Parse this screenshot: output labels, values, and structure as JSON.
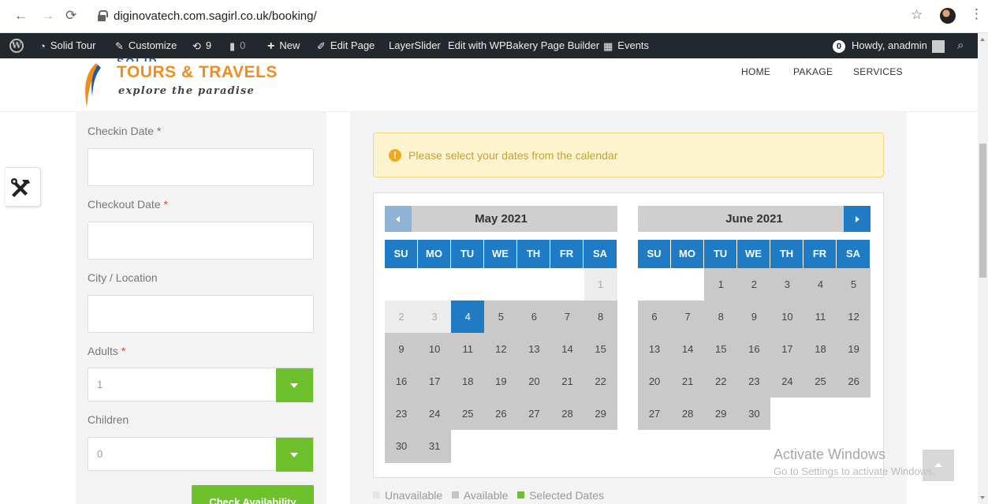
{
  "browser": {
    "url": "diginovatech.com.sagirl.co.uk/booking/"
  },
  "adminbar": {
    "site": "Solid Tour",
    "customize": "Customize",
    "updates": "9",
    "comments": "0",
    "new": "New",
    "edit_page": "Edit Page",
    "layerslider": "LayerSlider",
    "wpbakery": "Edit with WPBakery Page Builder",
    "events": "Events",
    "notif_count": "0",
    "howdy": "Howdy, anadmin"
  },
  "header": {
    "logo_top": "SOLID",
    "logo_title": "TOURS & TRAVELS",
    "logo_tagline": "explore the paradise",
    "nav": [
      "HOME",
      "PAKAGE",
      "SERVICES"
    ]
  },
  "form": {
    "checkin_label": "Checkin Date",
    "checkout_label": "Checkout Date",
    "city_label": "City / Location",
    "adults_label": "Adults",
    "adults_value": "1",
    "children_label": "Children",
    "children_value": "0",
    "required_mark": "*",
    "submit_label": "Check Availability"
  },
  "alert": {
    "text": "Please select your dates from the calendar"
  },
  "calendar": {
    "weekdays": [
      "SU",
      "MO",
      "TU",
      "WE",
      "TH",
      "FR",
      "SA"
    ],
    "months": [
      {
        "title": "May 2021",
        "cells": [
          {
            "d": "",
            "s": "empty"
          },
          {
            "d": "",
            "s": "empty"
          },
          {
            "d": "",
            "s": "empty"
          },
          {
            "d": "",
            "s": "empty"
          },
          {
            "d": "",
            "s": "empty"
          },
          {
            "d": "",
            "s": "empty"
          },
          {
            "d": "1",
            "s": "un"
          },
          {
            "d": "2",
            "s": "un"
          },
          {
            "d": "3",
            "s": "un"
          },
          {
            "d": "4",
            "s": "sel"
          },
          {
            "d": "5",
            "s": "av"
          },
          {
            "d": "6",
            "s": "av"
          },
          {
            "d": "7",
            "s": "av"
          },
          {
            "d": "8",
            "s": "av"
          },
          {
            "d": "9",
            "s": "av"
          },
          {
            "d": "10",
            "s": "av"
          },
          {
            "d": "11",
            "s": "av"
          },
          {
            "d": "12",
            "s": "av"
          },
          {
            "d": "13",
            "s": "av"
          },
          {
            "d": "14",
            "s": "av"
          },
          {
            "d": "15",
            "s": "av"
          },
          {
            "d": "16",
            "s": "av"
          },
          {
            "d": "17",
            "s": "av"
          },
          {
            "d": "18",
            "s": "av"
          },
          {
            "d": "19",
            "s": "av"
          },
          {
            "d": "20",
            "s": "av"
          },
          {
            "d": "21",
            "s": "av"
          },
          {
            "d": "22",
            "s": "av"
          },
          {
            "d": "23",
            "s": "av"
          },
          {
            "d": "24",
            "s": "av"
          },
          {
            "d": "25",
            "s": "av"
          },
          {
            "d": "26",
            "s": "av"
          },
          {
            "d": "27",
            "s": "av"
          },
          {
            "d": "28",
            "s": "av"
          },
          {
            "d": "29",
            "s": "av"
          },
          {
            "d": "30",
            "s": "av"
          },
          {
            "d": "31",
            "s": "av"
          },
          {
            "d": "",
            "s": "empty"
          },
          {
            "d": "",
            "s": "empty"
          },
          {
            "d": "",
            "s": "empty"
          },
          {
            "d": "",
            "s": "empty"
          },
          {
            "d": "",
            "s": "empty"
          }
        ]
      },
      {
        "title": "June 2021",
        "cells": [
          {
            "d": "",
            "s": "empty"
          },
          {
            "d": "",
            "s": "empty"
          },
          {
            "d": "1",
            "s": "av"
          },
          {
            "d": "2",
            "s": "av"
          },
          {
            "d": "3",
            "s": "av"
          },
          {
            "d": "4",
            "s": "av"
          },
          {
            "d": "5",
            "s": "av"
          },
          {
            "d": "6",
            "s": "av"
          },
          {
            "d": "7",
            "s": "av"
          },
          {
            "d": "8",
            "s": "av"
          },
          {
            "d": "9",
            "s": "av"
          },
          {
            "d": "10",
            "s": "av"
          },
          {
            "d": "11",
            "s": "av"
          },
          {
            "d": "12",
            "s": "av"
          },
          {
            "d": "13",
            "s": "av"
          },
          {
            "d": "14",
            "s": "av"
          },
          {
            "d": "15",
            "s": "av"
          },
          {
            "d": "16",
            "s": "av"
          },
          {
            "d": "17",
            "s": "av"
          },
          {
            "d": "18",
            "s": "av"
          },
          {
            "d": "19",
            "s": "av"
          },
          {
            "d": "20",
            "s": "av"
          },
          {
            "d": "21",
            "s": "av"
          },
          {
            "d": "22",
            "s": "av"
          },
          {
            "d": "23",
            "s": "av"
          },
          {
            "d": "24",
            "s": "av"
          },
          {
            "d": "25",
            "s": "av"
          },
          {
            "d": "26",
            "s": "av"
          },
          {
            "d": "27",
            "s": "av"
          },
          {
            "d": "28",
            "s": "av"
          },
          {
            "d": "29",
            "s": "av"
          },
          {
            "d": "30",
            "s": "av"
          },
          {
            "d": "",
            "s": "empty"
          },
          {
            "d": "",
            "s": "empty"
          },
          {
            "d": "",
            "s": "empty"
          },
          {
            "d": "",
            "s": "empty"
          },
          {
            "d": "",
            "s": "empty"
          },
          {
            "d": "",
            "s": "empty"
          },
          {
            "d": "",
            "s": "empty"
          },
          {
            "d": "",
            "s": "empty"
          },
          {
            "d": "",
            "s": "empty"
          },
          {
            "d": "",
            "s": "empty"
          }
        ]
      }
    ],
    "legend": {
      "unavailable": "Unavailable",
      "available": "Available",
      "selected": "Selected Dates"
    }
  },
  "watermark": {
    "line1": "Activate Windows",
    "line2": "Go to Settings to activate Windows."
  },
  "colors": {
    "accent_blue": "#1e7bc4",
    "green": "#6ec12c",
    "brand_orange": "#f28c1c",
    "admin_bar": "#23282d"
  }
}
